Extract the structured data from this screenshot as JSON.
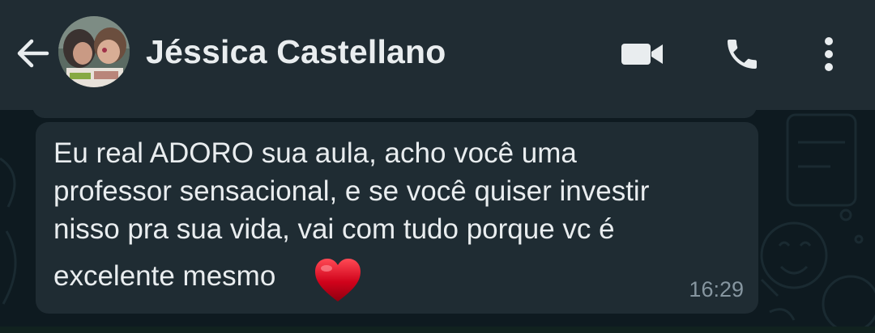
{
  "header": {
    "contact_name": "Jéssica Castellano",
    "back_icon": "arrow-left-icon",
    "video_icon": "video-camera-icon",
    "call_icon": "phone-icon",
    "menu_icon": "more-vertical-icon"
  },
  "message": {
    "lines": [
      "Eu real ADORO sua aula, acho você uma",
      "professor sensacional, e se você quiser investir",
      "nisso pra sua vida, vai com tudo porque vc é",
      "excelente mesmo"
    ],
    "emoji": "red-heart-icon",
    "time": "16:29"
  },
  "colors": {
    "header_bg": "#202c33",
    "chat_bg": "#0e1a20",
    "bubble_bg": "#1f2c33",
    "text": "#e9edef",
    "time_text": "#8696a0",
    "heart": "#d0021b"
  }
}
